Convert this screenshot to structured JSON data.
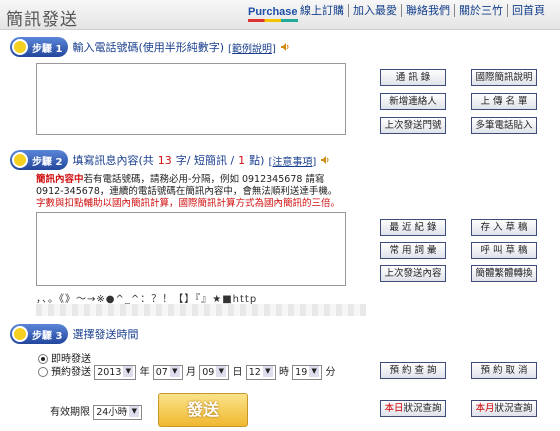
{
  "header": {
    "title": "簡訊發送",
    "purchase": "Purchase",
    "nav": [
      "線上訂購",
      "加入最愛",
      "聯絡我們",
      "關於三竹",
      "回首頁"
    ]
  },
  "step1": {
    "badge": "步驟 1",
    "text": "輸入電話號碼(使用半形純數字)",
    "link": "[範例說明]"
  },
  "step1_buttons": [
    "通 訊 錄",
    "國際簡訊說明",
    "新增連絡人",
    "上 傳 名 單",
    "上次發送門號",
    "多筆電話貼入"
  ],
  "step2": {
    "badge": "步驟 2",
    "text_prefix": "填寫訊息內容(共",
    "count": "13",
    "mid": "字/ 短簡訊 /",
    "pages": "1",
    "suffix": "點)",
    "link": "[注意事項]"
  },
  "notes": {
    "label": "簡訊內容中",
    "line1": "若有電話號碼，請務必用-分隔，例如 0912345678 請寫",
    "line2": "0912-345678，連續的電話號碼在簡訊內容中，會無法順利送達手機。",
    "warning": "字數與扣點輔助以國內簡訊計算，國際簡訊計算方式為國內簡訊的三倍。"
  },
  "step2_buttons": [
    "最 近 紀 錄",
    "存 入 草 稿",
    "常 用 詞 彙",
    "呼 叫 草 稿",
    "上次發送內容",
    "簡體繁體轉換"
  ],
  "symbols": "，、。《》～→※●^_^：？！【】『』★■http",
  "step3": {
    "badge": "步驟 3",
    "text": "選擇發送時間"
  },
  "schedule": {
    "immediate": "即時發送",
    "scheduled": "預約發送",
    "year": "2013",
    "year_unit": "年",
    "month": "07",
    "month_unit": "月",
    "day": "09",
    "day_unit": "日",
    "hour": "12",
    "hour_unit": "時",
    "minute": "19",
    "minute_unit": "分",
    "validity_label": "有效期限",
    "validity": "24小時"
  },
  "send_label": "發送",
  "step3_buttons": [
    "預 約 查 詢",
    "預 約 取 消"
  ],
  "status_buttons": {
    "today_prefix": "本日",
    "today_rest": "狀況查詢",
    "month_prefix": "本月",
    "month_rest": "狀況查詢"
  }
}
